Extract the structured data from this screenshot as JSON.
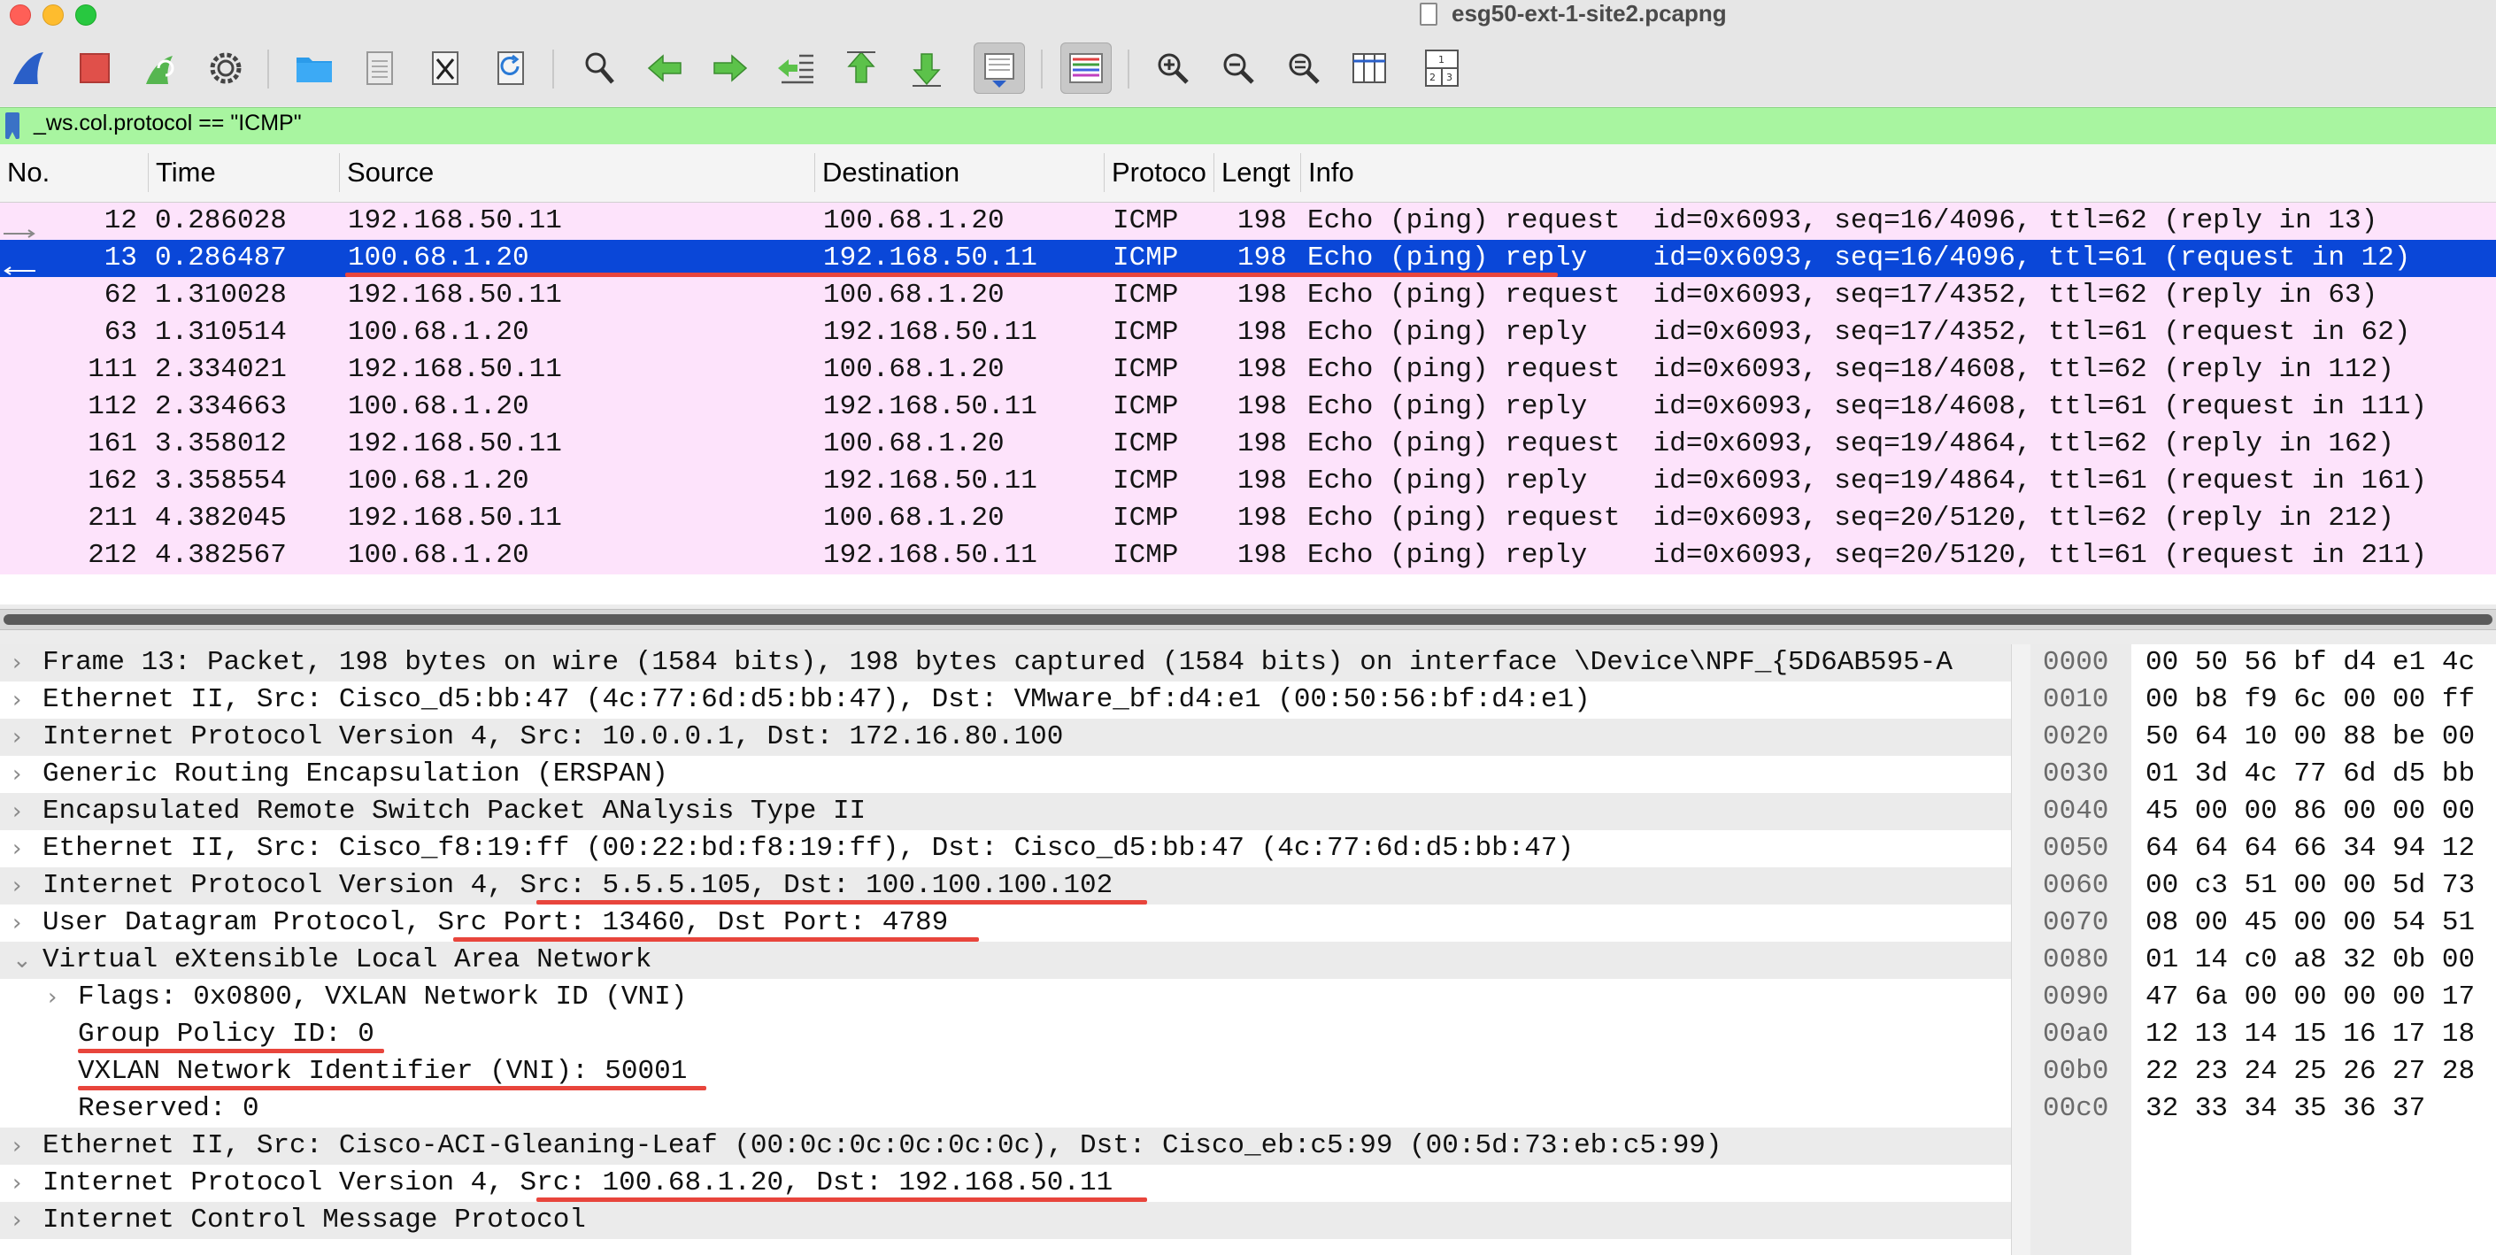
{
  "window": {
    "title": "esg50-ext-1-site2.pcapng"
  },
  "toolbar": {
    "buttons": [
      {
        "name": "start-capture",
        "icon": "shark-fin-icon"
      },
      {
        "name": "stop-capture",
        "icon": "stop-square-icon"
      },
      {
        "name": "restart-capture",
        "icon": "restart-fin-icon"
      },
      {
        "name": "capture-options",
        "icon": "gear-icon"
      },
      {
        "name": "open-file",
        "icon": "folder-icon"
      },
      {
        "name": "save-file",
        "icon": "file-save-icon"
      },
      {
        "name": "close-file",
        "icon": "file-close-icon"
      },
      {
        "name": "reload-file",
        "icon": "reload-icon"
      },
      {
        "name": "find-packet",
        "icon": "magnifier-icon"
      },
      {
        "name": "go-back",
        "icon": "arrow-left-icon"
      },
      {
        "name": "go-forward",
        "icon": "arrow-right-icon"
      },
      {
        "name": "go-to-packet",
        "icon": "go-to-packet-icon"
      },
      {
        "name": "go-first",
        "icon": "arrow-up-icon"
      },
      {
        "name": "go-last",
        "icon": "arrow-down-icon"
      },
      {
        "name": "auto-scroll",
        "icon": "auto-scroll-icon"
      },
      {
        "name": "colorize",
        "icon": "colorize-icon"
      },
      {
        "name": "zoom-in",
        "icon": "zoom-in-icon"
      },
      {
        "name": "zoom-out",
        "icon": "zoom-out-icon"
      },
      {
        "name": "normal-size",
        "icon": "zoom-reset-icon"
      },
      {
        "name": "resize-columns",
        "icon": "resize-columns-icon"
      },
      {
        "name": "layout",
        "icon": "layout-icon"
      }
    ]
  },
  "filter": {
    "value": "_ws.col.protocol == \"ICMP\""
  },
  "packet_list": {
    "columns": [
      "No.",
      "Time",
      "Source",
      "Destination",
      "Protoco",
      "Lengt",
      "Info"
    ],
    "rows": [
      {
        "no": "12",
        "time": "0.286028",
        "src": "192.168.50.11",
        "dst": "100.68.1.20",
        "proto": "ICMP",
        "len": "198",
        "info": "Echo (ping) request  id=0x6093, seq=16/4096, ttl=62 (reply in 13)"
      },
      {
        "no": "13",
        "time": "0.286487",
        "src": "100.68.1.20",
        "dst": "192.168.50.11",
        "proto": "ICMP",
        "len": "198",
        "info": "Echo (ping) reply    id=0x6093, seq=16/4096, ttl=61 (request in 12)"
      },
      {
        "no": "62",
        "time": "1.310028",
        "src": "192.168.50.11",
        "dst": "100.68.1.20",
        "proto": "ICMP",
        "len": "198",
        "info": "Echo (ping) request  id=0x6093, seq=17/4352, ttl=62 (reply in 63)"
      },
      {
        "no": "63",
        "time": "1.310514",
        "src": "100.68.1.20",
        "dst": "192.168.50.11",
        "proto": "ICMP",
        "len": "198",
        "info": "Echo (ping) reply    id=0x6093, seq=17/4352, ttl=61 (request in 62)"
      },
      {
        "no": "111",
        "time": "2.334021",
        "src": "192.168.50.11",
        "dst": "100.68.1.20",
        "proto": "ICMP",
        "len": "198",
        "info": "Echo (ping) request  id=0x6093, seq=18/4608, ttl=62 (reply in 112)"
      },
      {
        "no": "112",
        "time": "2.334663",
        "src": "100.68.1.20",
        "dst": "192.168.50.11",
        "proto": "ICMP",
        "len": "198",
        "info": "Echo (ping) reply    id=0x6093, seq=18/4608, ttl=61 (request in 111)"
      },
      {
        "no": "161",
        "time": "3.358012",
        "src": "192.168.50.11",
        "dst": "100.68.1.20",
        "proto": "ICMP",
        "len": "198",
        "info": "Echo (ping) request  id=0x6093, seq=19/4864, ttl=62 (reply in 162)"
      },
      {
        "no": "162",
        "time": "3.358554",
        "src": "100.68.1.20",
        "dst": "192.168.50.11",
        "proto": "ICMP",
        "len": "198",
        "info": "Echo (ping) reply    id=0x6093, seq=19/4864, ttl=61 (request in 161)"
      },
      {
        "no": "211",
        "time": "4.382045",
        "src": "192.168.50.11",
        "dst": "100.68.1.20",
        "proto": "ICMP",
        "len": "198",
        "info": "Echo (ping) request  id=0x6093, seq=20/5120, ttl=62 (reply in 212)"
      },
      {
        "no": "212",
        "time": "4.382567",
        "src": "100.68.1.20",
        "dst": "192.168.50.11",
        "proto": "ICMP",
        "len": "198",
        "info": "Echo (ping) reply    id=0x6093, seq=20/5120, ttl=61 (request in 211)"
      }
    ],
    "selected_row": "13"
  },
  "details": {
    "rows": [
      {
        "text": "Frame 13: Packet, 198 bytes on wire (1584 bits), 198 bytes captured (1584 bits) on interface \\Device\\NPF_{5D6AB595-A",
        "expander": "collapsed"
      },
      {
        "text": "Ethernet II, Src: Cisco_d5:bb:47 (4c:77:6d:d5:bb:47), Dst: VMware_bf:d4:e1 (00:50:56:bf:d4:e1)",
        "expander": "collapsed"
      },
      {
        "text": "Internet Protocol Version 4, Src: 10.0.0.1, Dst: 172.16.80.100",
        "expander": "collapsed"
      },
      {
        "text": "Generic Routing Encapsulation (ERSPAN)",
        "expander": "collapsed"
      },
      {
        "text": "Encapsulated Remote Switch Packet ANalysis Type II",
        "expander": "collapsed"
      },
      {
        "text": "Ethernet II, Src: Cisco_f8:19:ff (00:22:bd:f8:19:ff), Dst: Cisco_d5:bb:47 (4c:77:6d:d5:bb:47)",
        "expander": "collapsed"
      },
      {
        "text": "Internet Protocol Version 4, Src: 5.5.5.105, Dst: 100.100.100.102",
        "expander": "collapsed"
      },
      {
        "text": "User Datagram Protocol, Src Port: 13460, Dst Port: 4789",
        "expander": "collapsed"
      },
      {
        "text": "Virtual eXtensible Local Area Network",
        "expander": "expanded"
      },
      {
        "text": "Flags: 0x0800, VXLAN Network ID (VNI)",
        "expander": "collapsed"
      },
      {
        "text": "Group Policy ID: 0",
        "expander": "none"
      },
      {
        "text": "VXLAN Network Identifier (VNI): 50001",
        "expander": "none"
      },
      {
        "text": "Reserved: 0",
        "expander": "none"
      },
      {
        "text": "Ethernet II, Src: Cisco-ACI-Gleaning-Leaf (00:0c:0c:0c:0c:0c), Dst: Cisco_eb:c5:99 (00:5d:73:eb:c5:99)",
        "expander": "collapsed"
      },
      {
        "text": "Internet Protocol Version 4, Src: 100.68.1.20, Dst: 192.168.50.11",
        "expander": "collapsed"
      },
      {
        "text": "Internet Control Message Protocol",
        "expander": "collapsed"
      }
    ]
  },
  "hex": {
    "offsets": [
      "0000",
      "0010",
      "0020",
      "0030",
      "0040",
      "0050",
      "0060",
      "0070",
      "0080",
      "0090",
      "00a0",
      "00b0",
      "00c0"
    ],
    "bytes": [
      "00 50 56 bf d4 e1 4c",
      "00 b8 f9 6c 00 00 ff",
      "50 64 10 00 88 be 00",
      "01 3d 4c 77 6d d5 bb",
      "45 00 00 86 00 00 00",
      "64 64 64 66 34 94 12",
      "00 c3 51 00 00 5d 73",
      "08 00 45 00 00 54 51",
      "01 14 c0 a8 32 0b 00",
      "47 6a 00 00 00 00 17",
      "12 13 14 15 16 17 18",
      "22 23 24 25 26 27 28",
      "32 33 34 35 36 37"
    ]
  },
  "colors": {
    "filter_bg": "#a8f5a0",
    "row_bg": "#fde3fb",
    "selected_bg": "#0a47d8",
    "annotation_underline": "#e8453c"
  }
}
